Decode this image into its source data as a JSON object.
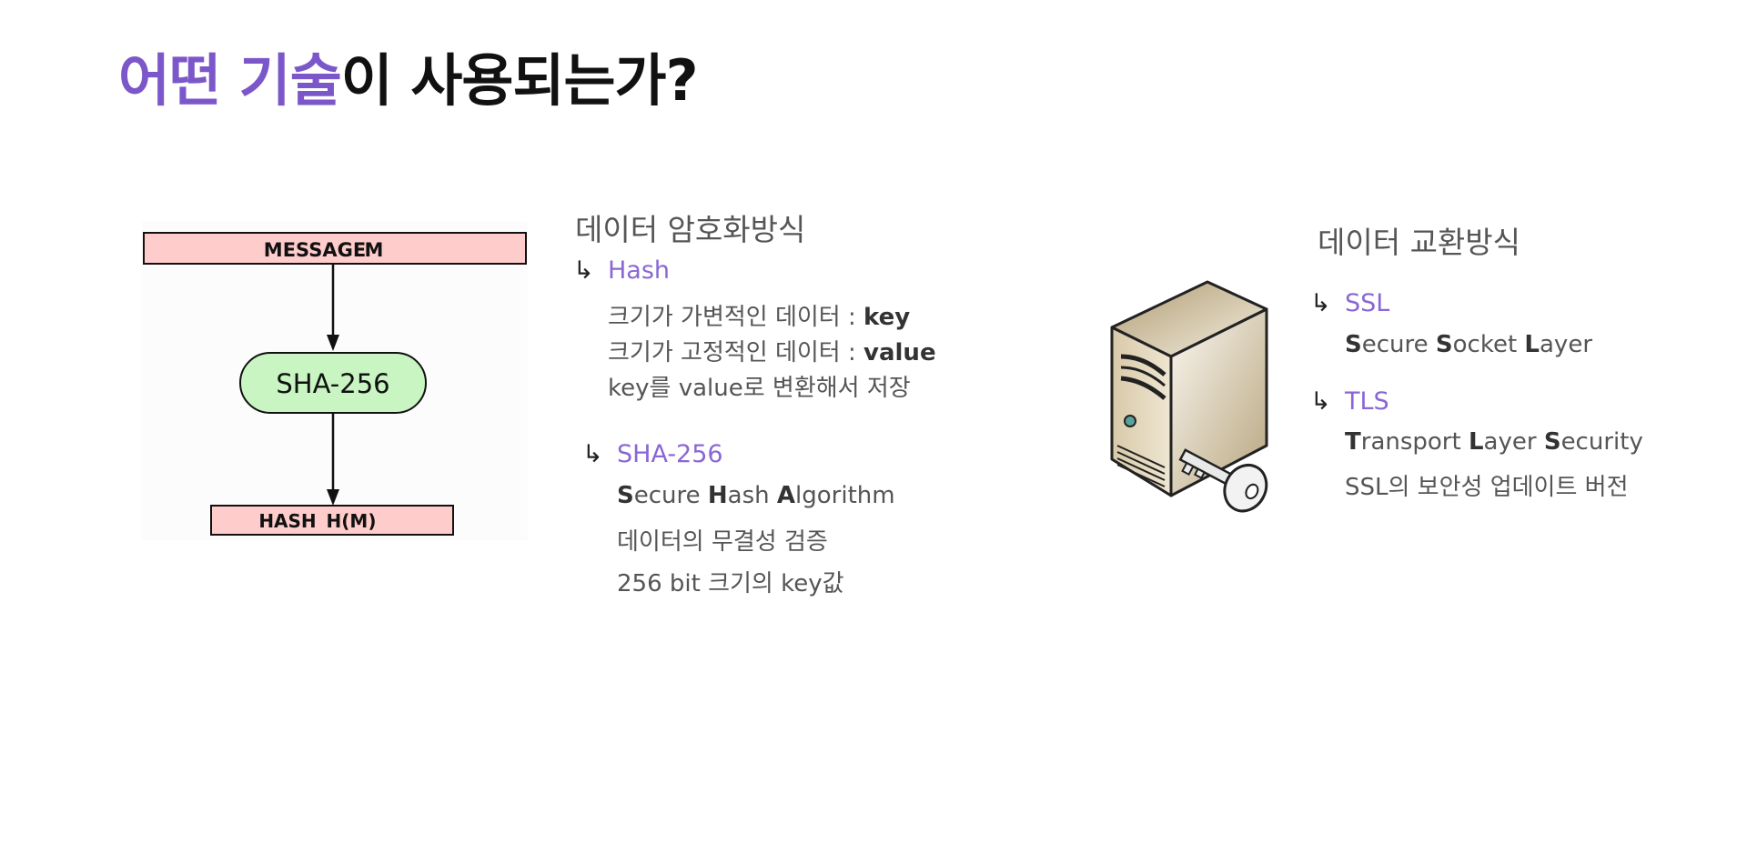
{
  "title": {
    "accent": "어떤 기술",
    "rest": "이 사용되는가?"
  },
  "diagram": {
    "message_label": "MESSAGE",
    "message_var": "M",
    "function_label": "SHA-256",
    "hash_label": "HASH",
    "hash_var": "H(M)"
  },
  "encryption": {
    "heading": "데이터 암호화방식",
    "hash": {
      "arrow": "↳",
      "label": "Hash",
      "line1_text": "크기가 가변적인 데이터 : ",
      "line1_bold": "key",
      "line2_text": "크기가 고정적인 데이터 : ",
      "line2_bold": "value",
      "line3": "key를 value로 변환해서 저장"
    },
    "sha": {
      "arrow": "↳",
      "label": "SHA-256",
      "expansion": [
        {
          "b": "S",
          "t": "ecure "
        },
        {
          "b": "H",
          "t": "ash "
        },
        {
          "b": "A",
          "t": "lgorithm"
        }
      ],
      "line2": "데이터의 무결성 검증",
      "line3": "256 bit 크기의 key값"
    }
  },
  "exchange": {
    "heading": "데이터 교환방식",
    "ssl": {
      "arrow": "↳",
      "label": "SSL",
      "expansion": [
        {
          "b": "S",
          "t": "ecure "
        },
        {
          "b": "S",
          "t": "ocket "
        },
        {
          "b": "L",
          "t": "ayer"
        }
      ]
    },
    "tls": {
      "arrow": "↳",
      "label": "TLS",
      "expansion": [
        {
          "b": "T",
          "t": "ransport "
        },
        {
          "b": "L",
          "t": "ayer "
        },
        {
          "b": "S",
          "t": "ecurity"
        }
      ],
      "line2": "SSL의 보안성 업데이트 버전"
    }
  },
  "icons": {
    "server": "server-with-key-icon",
    "arrow": "hook-arrow-icon"
  },
  "colors": {
    "accent": "#7b57c9",
    "label": "#8a67d4",
    "message_box": "#ffcccc",
    "function_box": "#c8f5c2"
  }
}
